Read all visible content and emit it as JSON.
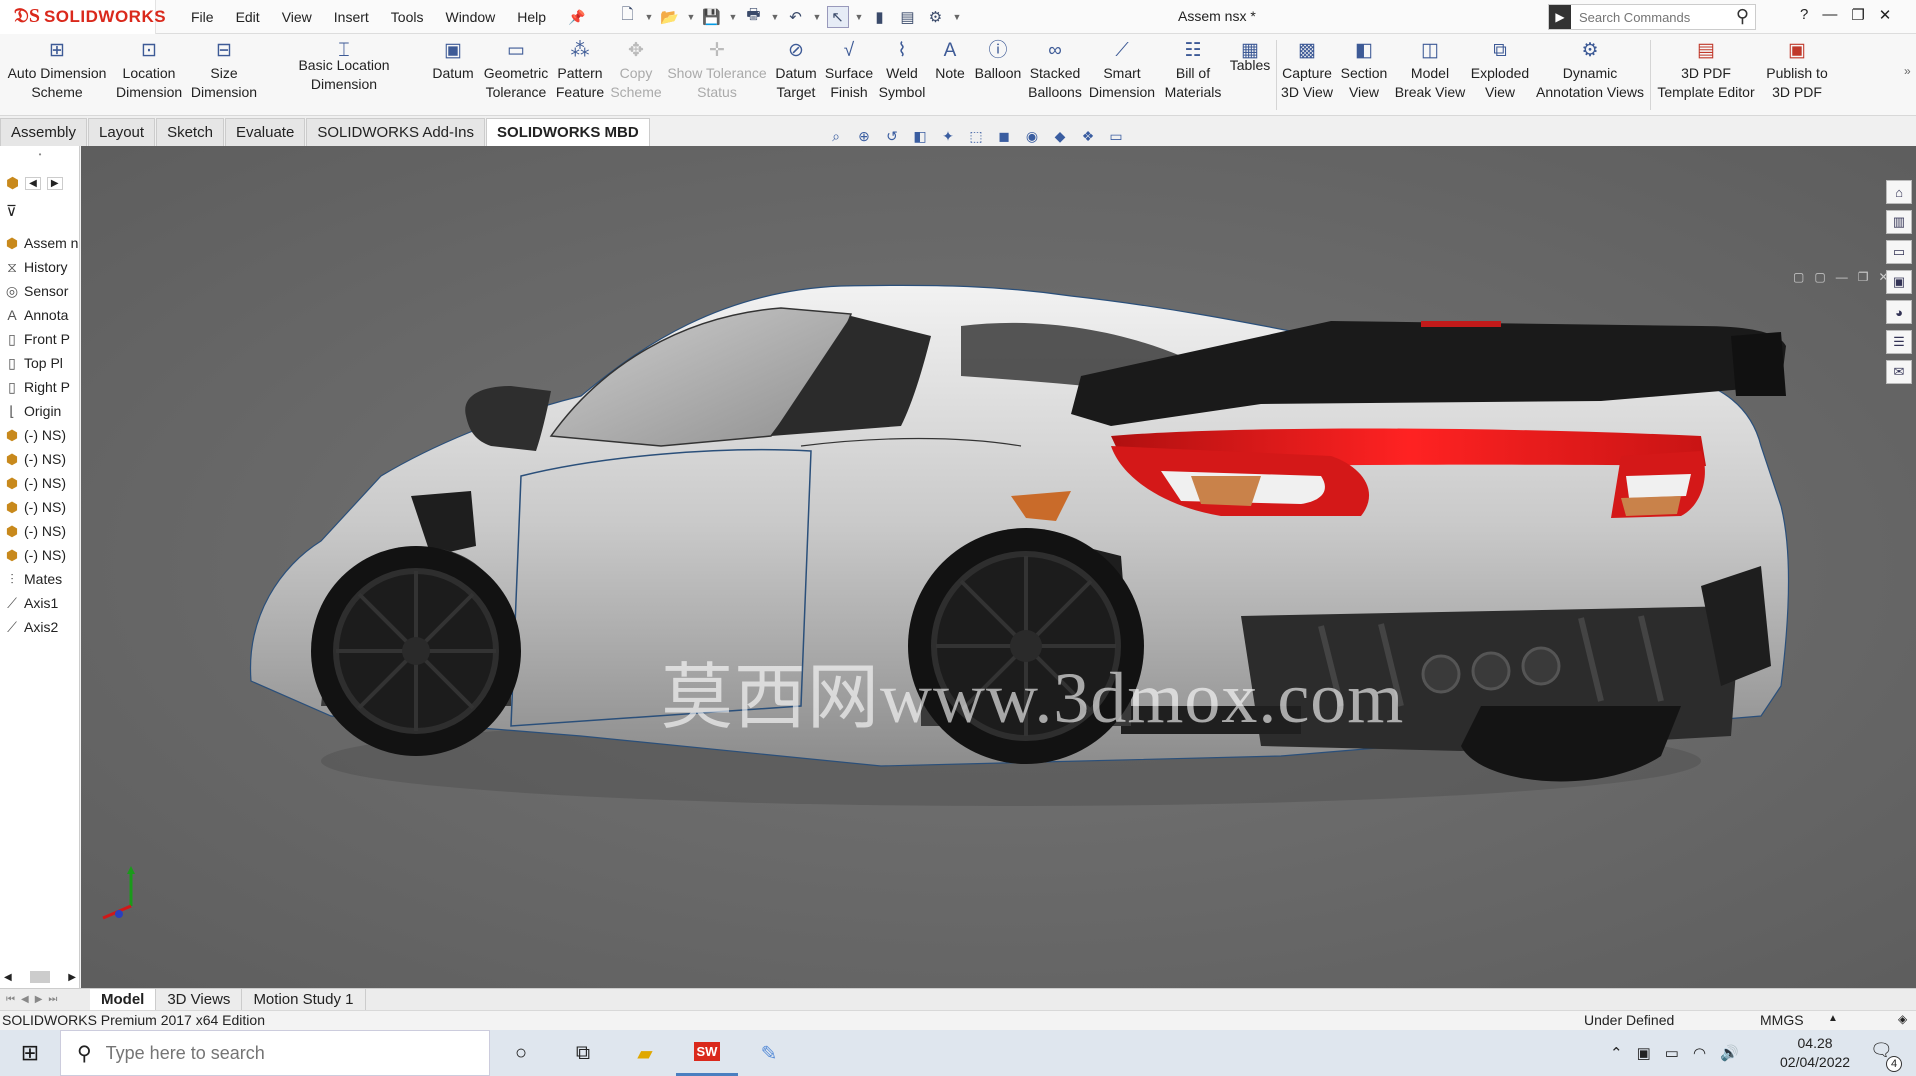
{
  "app": {
    "brand": "SOLIDWORKS",
    "document_title": "Assem nsx *"
  },
  "menu": [
    "File",
    "Edit",
    "View",
    "Insert",
    "Tools",
    "Window",
    "Help"
  ],
  "search": {
    "placeholder": "Search Commands"
  },
  "ribbon": {
    "commands": [
      {
        "label": "Auto Dimension\nScheme",
        "icon": "auto-dimension-icon",
        "enabled": true
      },
      {
        "label": "Location\nDimension",
        "icon": "location-dimension-icon",
        "enabled": true
      },
      {
        "label": "Size\nDimension",
        "icon": "size-dimension-icon",
        "enabled": true
      },
      {
        "label": "Basic Location Dimension",
        "icon": "basic-location-dimension-icon",
        "enabled": true
      },
      {
        "label": "Datum",
        "icon": "datum-icon",
        "enabled": true
      },
      {
        "label": "Geometric\nTolerance",
        "icon": "geometric-tolerance-icon",
        "enabled": true
      },
      {
        "label": "Pattern\nFeature",
        "icon": "pattern-feature-icon",
        "enabled": true
      },
      {
        "label": "Copy\nScheme",
        "icon": "copy-scheme-icon",
        "enabled": false
      },
      {
        "label": "Show Tolerance\nStatus",
        "icon": "show-tolerance-icon",
        "enabled": false
      },
      {
        "label": "Datum\nTarget",
        "icon": "datum-target-icon",
        "enabled": true
      },
      {
        "label": "Surface\nFinish",
        "icon": "surface-finish-icon",
        "enabled": true
      },
      {
        "label": "Weld\nSymbol",
        "icon": "weld-symbol-icon",
        "enabled": true
      },
      {
        "label": "Note",
        "icon": "note-icon",
        "enabled": true
      },
      {
        "label": "Balloon",
        "icon": "balloon-icon",
        "enabled": true
      },
      {
        "label": "Stacked\nBalloons",
        "icon": "stacked-balloons-icon",
        "enabled": true
      },
      {
        "label": "Smart\nDimension",
        "icon": "smart-dimension-icon",
        "enabled": true
      },
      {
        "label": "Bill of\nMaterials",
        "icon": "bill-of-materials-icon",
        "enabled": true
      },
      {
        "label": "Tables",
        "icon": "tables-icon",
        "enabled": true
      },
      {
        "label": "Capture\n3D View",
        "icon": "capture-3d-view-icon",
        "enabled": true
      },
      {
        "label": "Section\nView",
        "icon": "section-view-icon",
        "enabled": true
      },
      {
        "label": "Model\nBreak View",
        "icon": "model-break-view-icon",
        "enabled": true
      },
      {
        "label": "Exploded\nView",
        "icon": "exploded-view-icon",
        "enabled": true
      },
      {
        "label": "Dynamic\nAnnotation Views",
        "icon": "dynamic-annotation-views-icon",
        "enabled": true
      },
      {
        "label": "3D PDF\nTemplate Editor",
        "icon": "pdf-template-editor-icon",
        "enabled": true
      },
      {
        "label": "Publish to\n3D PDF",
        "icon": "publish-3d-pdf-icon",
        "enabled": true
      }
    ]
  },
  "tabs": [
    "Assembly",
    "Layout",
    "Sketch",
    "Evaluate",
    "SOLIDWORKS Add-Ins",
    "SOLIDWORKS MBD"
  ],
  "active_tab": "SOLIDWORKS MBD",
  "tree": [
    {
      "label": "Assem nsx",
      "icon": "assembly-icon"
    },
    {
      "label": "History",
      "icon": "history-icon"
    },
    {
      "label": "Sensor",
      "icon": "sensor-icon"
    },
    {
      "label": "Annota",
      "icon": "annotations-icon"
    },
    {
      "label": "Front P",
      "icon": "plane-icon"
    },
    {
      "label": "Top Pl",
      "icon": "plane-icon"
    },
    {
      "label": "Right P",
      "icon": "plane-icon"
    },
    {
      "label": "Origin",
      "icon": "origin-icon"
    },
    {
      "label": "(-) NS)",
      "icon": "part-icon"
    },
    {
      "label": "(-) NS)",
      "icon": "part-icon"
    },
    {
      "label": "(-) NS)",
      "icon": "part-icon"
    },
    {
      "label": "(-) NS)",
      "icon": "part-icon"
    },
    {
      "label": "(-) NS)",
      "icon": "part-icon"
    },
    {
      "label": "(-) NS)",
      "icon": "part-icon"
    },
    {
      "label": "Mates",
      "icon": "mates-icon"
    },
    {
      "label": "Axis1",
      "icon": "axis-icon"
    },
    {
      "label": "Axis2",
      "icon": "axis-icon"
    }
  ],
  "viewport": {
    "watermark": "莫西网www.3dmox.com"
  },
  "bottom_tabs": [
    "Model",
    "3D Views",
    "Motion Study 1"
  ],
  "active_bottom_tab": "Model",
  "status": {
    "edition": "SOLIDWORKS Premium 2017 x64 Edition",
    "state": "Under Defined",
    "units": "MMGS"
  },
  "taskbar": {
    "search_placeholder": "Type here to search",
    "time": "04.28",
    "date": "02/04/2022",
    "notifications": "4"
  },
  "colors": {
    "brand_red": "#da291c",
    "viewport_bg": "#6b6b6b",
    "icon_blue": "#3d5a96",
    "taillight_red": "#e01818"
  }
}
